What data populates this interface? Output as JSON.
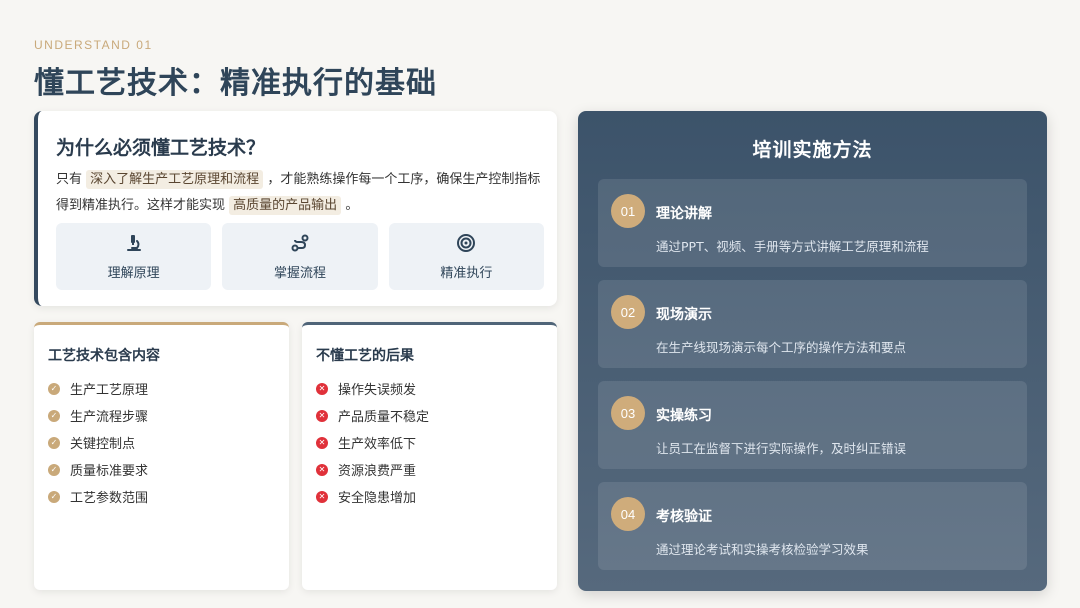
{
  "header": {
    "eyebrow": "UNDERSTAND 01",
    "title": "懂工艺技术：精准执行的基础"
  },
  "why": {
    "title": "为什么必须懂工艺技术？",
    "text_1": "只有",
    "highlight_1": "深入了解生产工艺原理和流程",
    "text_2": "，才能熟练操作每一个工序，确保生产控制指标得到精准执行。这样才能实现",
    "highlight_2": "高质量的产品输出",
    "text_3": "。",
    "pills": [
      {
        "icon": "microscope-icon",
        "label": "理解原理"
      },
      {
        "icon": "route-icon",
        "label": "掌握流程"
      },
      {
        "icon": "target-icon",
        "label": "精准执行"
      }
    ]
  },
  "content_card": {
    "title": "工艺技术包含内容",
    "items": [
      "生产工艺原理",
      "生产流程步骤",
      "关键控制点",
      "质量标准要求",
      "工艺参数范围"
    ]
  },
  "consequence_card": {
    "title": "不懂工艺的后果",
    "items": [
      "操作失误频发",
      "产品质量不稳定",
      "生产效率低下",
      "资源浪费严重",
      "安全隐患增加"
    ]
  },
  "method": {
    "title": "培训实施方法",
    "steps": [
      {
        "num": "01",
        "title": "理论讲解",
        "desc": "通过PPT、视频、手册等方式讲解工艺原理和流程"
      },
      {
        "num": "02",
        "title": "现场演示",
        "desc": "在生产线现场演示每个工序的操作方法和要点"
      },
      {
        "num": "03",
        "title": "实操练习",
        "desc": "让员工在监督下进行实际操作，及时纠正错误"
      },
      {
        "num": "04",
        "title": "考核验证",
        "desc": "通过理论考试和实操考核检验学习效果"
      }
    ]
  },
  "colors": {
    "accent_gold": "#c9a97a",
    "navy": "#2f4559",
    "error_red": "#e0313a"
  }
}
